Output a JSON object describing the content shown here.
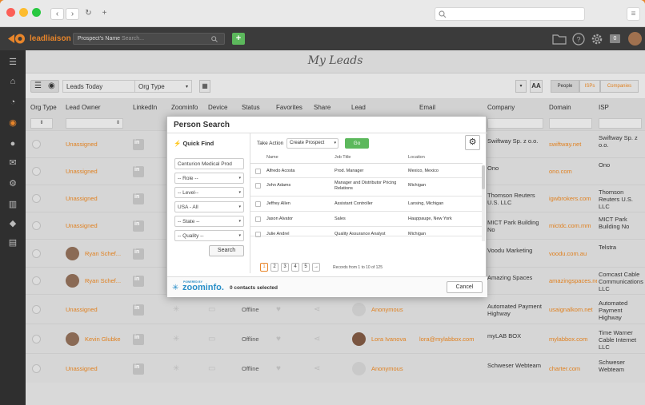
{
  "browser": {
    "nav_back": "‹",
    "nav_forward": "›",
    "reload": "↻",
    "new_tab": "+",
    "menu": "≡"
  },
  "app": {
    "brand": "leadliaison",
    "search_scope": "Prospect's Name",
    "search_placeholder": "Search...",
    "add_label": "+",
    "badge": "0",
    "page_title": "My Leads"
  },
  "toolbar": {
    "view_selector": "Leads Today",
    "org_type": "Org Type",
    "aa_label": "AA",
    "tabs": [
      "People",
      "ISPs",
      "Companies"
    ]
  },
  "columns": [
    "Org Type",
    "Lead Owner",
    "LinkedIn",
    "Zoominfo",
    "Device",
    "Status",
    "Favorites",
    "Share",
    "Lead",
    "Email",
    "Company",
    "Domain",
    "ISP"
  ],
  "rows": [
    {
      "owner": "Unassigned",
      "avatar": false,
      "status": "",
      "lead": "",
      "email": "",
      "company": "Swiftway Sp. z o.o.",
      "domain": "swiftway.net",
      "isp": "Swiftway Sp. z o.o."
    },
    {
      "owner": "Unassigned",
      "avatar": false,
      "status": "",
      "lead": "",
      "email": "",
      "company": "Ono",
      "domain": "ono.com",
      "isp": "Ono"
    },
    {
      "owner": "Unassigned",
      "avatar": false,
      "status": "",
      "lead": "",
      "email": "",
      "company": "Thomson Reuters U.S. LLC",
      "domain": "igwbrokers.com",
      "isp": "Thomson Reuters U.S. LLC"
    },
    {
      "owner": "Unassigned",
      "avatar": false,
      "status": "",
      "lead": "",
      "email": "",
      "company": "MICT Park Building No",
      "domain": "mictdc.com.mm",
      "isp": "MICT Park Building No"
    },
    {
      "owner": "Ryan Schef...",
      "avatar": true,
      "status": "",
      "lead": "",
      "email": "",
      "company": "Voodu Marketing",
      "domain": "voodu.com.au",
      "isp": "Telstra"
    },
    {
      "owner": "Ryan Schef...",
      "avatar": true,
      "status": "",
      "lead": "",
      "email": "",
      "company": "Amazing Spaces",
      "domain": "amazingspaces.net",
      "isp": "Comcast Cable Communications LLC"
    },
    {
      "owner": "Unassigned",
      "avatar": false,
      "status": "Offline",
      "lead": "Anonymous",
      "email": "",
      "company": "Automated Payment Highway",
      "domain": "usaignalkom.net",
      "isp": "Automated Payment Highway"
    },
    {
      "owner": "Kevin Glubke",
      "avatar": true,
      "status": "Offline",
      "lead": "Lora Ivanova",
      "email": "lora@mylabbox.com",
      "company": "myLAB BOX",
      "domain": "mylabbox.com",
      "isp": "Time Warner Cable Internet LLC"
    },
    {
      "owner": "Unassigned",
      "avatar": false,
      "status": "Offline",
      "lead": "Anonymous",
      "email": "",
      "company": "Schweser Webteam",
      "domain": "charter.com",
      "isp": "Schweser Webteam"
    }
  ],
  "modal": {
    "title": "Person Search",
    "quick_find": "Quick Find",
    "take_action_label": "Take Action",
    "action_value": "Create Prospect",
    "go_label": "Go",
    "company_value": "Centurion Medical Prod",
    "role": "-- Role --",
    "level": "-- Level--",
    "country": "USA - All",
    "state": "-- State --",
    "quality": "-- Quality --",
    "search_btn": "Search",
    "col_name": "Name",
    "col_job": "Job Title",
    "col_location": "Location",
    "results": [
      {
        "name": "Alfredo Acosta",
        "title": "Prod. Manager",
        "location": "Mexico, Mexico"
      },
      {
        "name": "John Adams",
        "title": "Manager and Distributor Pricing Relations",
        "location": "Michigan"
      },
      {
        "name": "Jeffrey Allen",
        "title": "Assistant Controller",
        "location": "Lansing, Michigan"
      },
      {
        "name": "Jason Alvator",
        "title": "Sales",
        "location": "Hauppauge, New York"
      },
      {
        "name": "Julie Andrel",
        "title": "Quality Assurance Analyst",
        "location": "Michigan"
      }
    ],
    "pages": [
      "1",
      "2",
      "3",
      "4",
      "5",
      "→"
    ],
    "records": "Records from 1 to 10 of 125",
    "powered_by": "POWERED BY",
    "zoominfo": "zoominfo.",
    "selected": "0 contacts selected",
    "cancel": "Cancel"
  },
  "colors": {
    "accent": "#e0801f",
    "green": "#5cb85c",
    "dark": "#3b3b3b"
  }
}
